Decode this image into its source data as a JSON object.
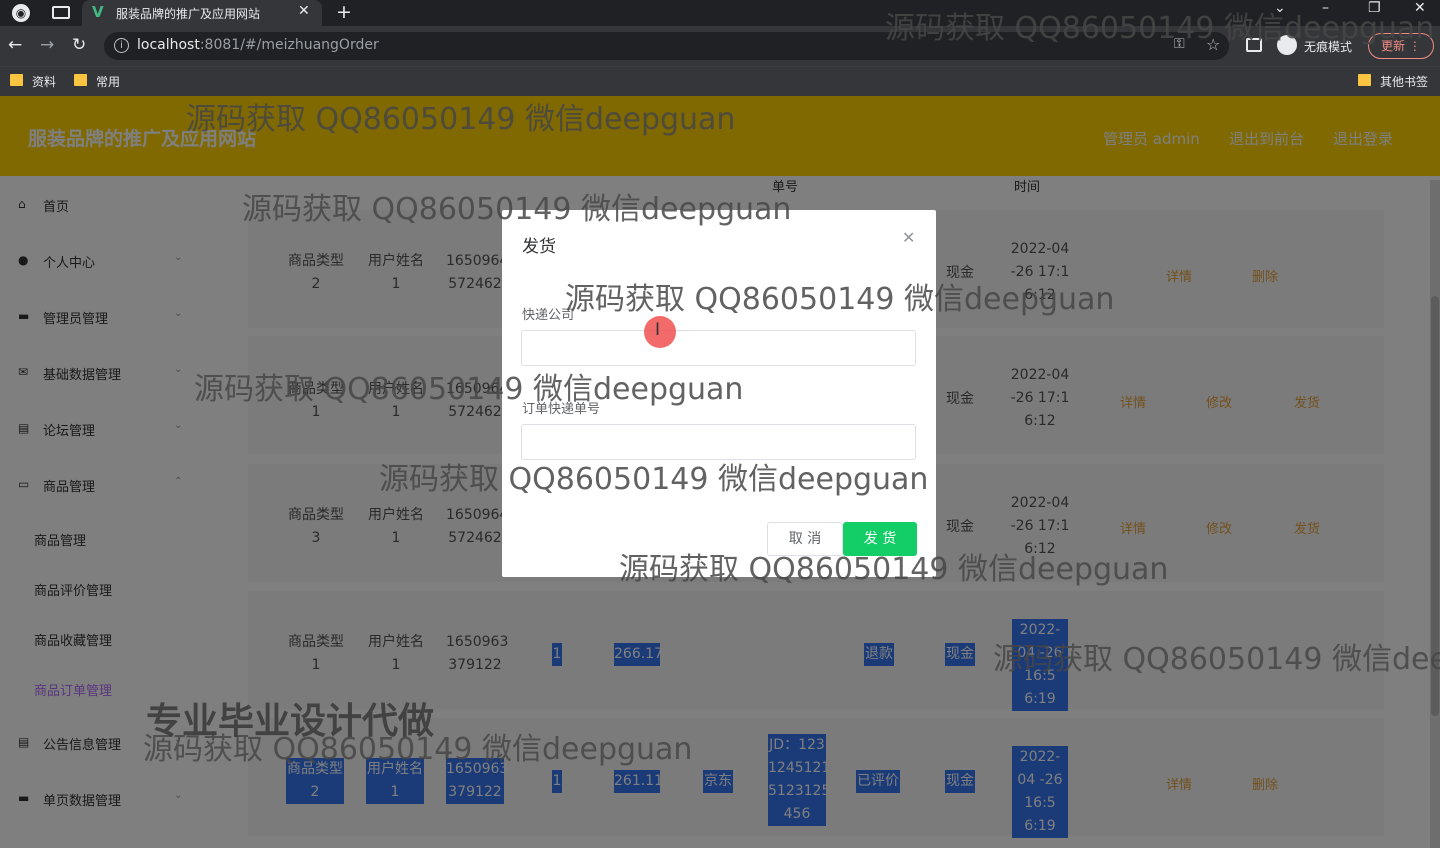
{
  "browser": {
    "tab_title": "服装品牌的推广及应用网站",
    "url_host": "localhost",
    "url_rest": ":8081/#/meizhuangOrder",
    "incognito_label": "无痕模式",
    "update_label": "更新",
    "bookmarks": [
      "资料",
      "常用"
    ],
    "other_bookmarks": "其他书签",
    "win_controls": [
      "⌄",
      "–",
      "❐",
      "✕"
    ]
  },
  "header": {
    "site_title": "服装品牌的推广及应用网站",
    "admin_label": "管理员 admin",
    "back_to_front": "退出到前台",
    "logout": "退出登录"
  },
  "sidebar": {
    "items": [
      {
        "label": "首页",
        "icon": "home-icon"
      },
      {
        "label": "个人中心",
        "icon": "user-icon"
      },
      {
        "label": "管理员管理",
        "icon": "admin-icon"
      },
      {
        "label": "基础数据管理",
        "icon": "mail-icon"
      },
      {
        "label": "论坛管理",
        "icon": "forum-icon"
      },
      {
        "label": "商品管理",
        "icon": "goods-icon"
      },
      {
        "label": "公告信息管理",
        "icon": "notice-icon"
      },
      {
        "label": "单页数据管理",
        "icon": "page-icon"
      }
    ],
    "sub_items": [
      "商品管理",
      "商品评价管理",
      "商品收藏管理",
      "商品订单管理"
    ]
  },
  "table": {
    "headers": [
      "单号",
      "时间"
    ],
    "rows": [
      {
        "type": "商品类型 2",
        "user": "用户姓名 1",
        "order_no": "1650964 572462",
        "count": "",
        "amount": "",
        "company": "",
        "status": "",
        "pay": "现金",
        "time": "2022-04 -26 17:1 6:12",
        "actions": [
          "详情",
          "删除"
        ]
      },
      {
        "type": "商品类型 1",
        "user": "用户姓名 1",
        "order_no": "1650964 572462",
        "count": "",
        "amount": "",
        "company": "",
        "status": "",
        "pay": "现金",
        "time": "2022-04 -26 17:1 6:12",
        "actions": [
          "详情",
          "修改",
          "发货"
        ]
      },
      {
        "type": "商品类型 3",
        "user": "用户姓名 1",
        "order_no": "1650964 572462",
        "count": "",
        "amount": "",
        "company": "",
        "status": "",
        "pay": "现金",
        "time": "2022-04 -26 17:1 6:12",
        "actions": [
          "详情",
          "修改",
          "发货"
        ]
      },
      {
        "type": "商品类型 1",
        "user": "用户姓名 1",
        "order_no": "1650963 379122",
        "count": "1",
        "amount": "266.17",
        "company": "",
        "status": "退款",
        "pay": "现金",
        "time": "2022-04 -26 16:5 6:19",
        "actions": []
      },
      {
        "type": "商品类型 2",
        "user": "用户姓名 1",
        "order_no": "1650963 379122",
        "count": "1",
        "amount": "261.11",
        "company": "京东",
        "status": "已评价",
        "pay": "现金",
        "time": "2022-04 -26 16:5 6:19",
        "actions": [
          "详情",
          "删除"
        ]
      }
    ],
    "express_no": "JD：123 1245121 5123125 456"
  },
  "dialog": {
    "title": "发货",
    "company_label": "快递公司",
    "tracking_label": "订单快递单号",
    "company_value": "",
    "tracking_value": "",
    "cancel_label": "取 消",
    "confirm_label": "发 货"
  },
  "watermarks": {
    "contact": "源码获取 QQ86050149 微信deepguan",
    "contact_cut": "源码获取 QQ86050149 微信dee",
    "ad": "专业毕业设计代做"
  }
}
